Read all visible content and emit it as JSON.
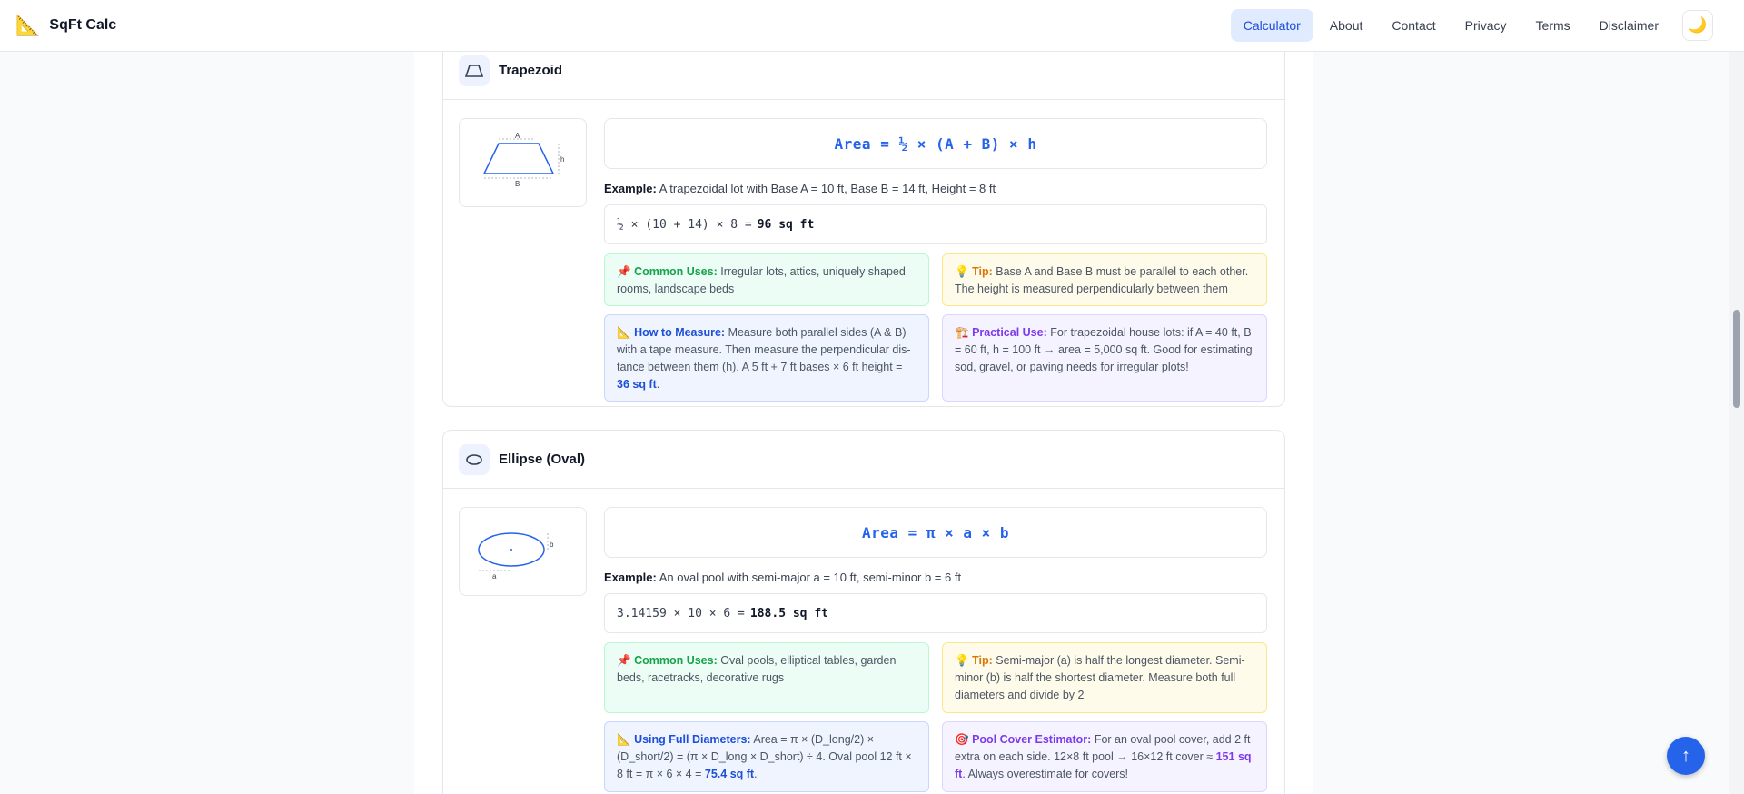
{
  "header": {
    "logo_icon": "📐",
    "app_name": "SqFt Calc",
    "nav": [
      "Calculator",
      "About",
      "Contact",
      "Privacy",
      "Terms",
      "Disclaimer"
    ],
    "active_nav": "Calculator",
    "theme_icon": "🌙"
  },
  "trapezoid": {
    "title": "Trapezoid",
    "diagram_labels": {
      "top": "A",
      "bottom": "B",
      "height": "h"
    },
    "formula": "Area = ½ × (A + B) × h",
    "example_label": "Example:",
    "example_text": "A trapezoidal lot with Base A = 10 ft, Base B = 14 ft, Height = 8 ft",
    "calc_expr": "½ × (10 + 14) × 8 =",
    "calc_result": "96 sq ft",
    "tips": {
      "common": {
        "icon": "📌",
        "label": "Common Uses:",
        "text": "Irregular lots, attics, uniquely shaped rooms, landscape beds"
      },
      "tip": {
        "icon": "💡",
        "label": "Tip:",
        "text": "Base A and Base B must be parallel to each other. The height is measured perpendicularly between them"
      },
      "measure": {
        "icon": "📐",
        "label": "How to Measure:",
        "text": "Measure both parallel sides (A & B) with a tape measure. Then measure the perpendicular dis­tance between them (h). A 5 ft + 7 ft bases × 6 ft height =",
        "highlight": "36 sq ft",
        "end": "."
      },
      "practical": {
        "icon": "🏗️",
        "label": "Practical Use:",
        "text": "For trapezoidal house lots: if A = 40 ft, B = 60 ft, h = 100 ft → area = 5,000 sq ft. Good for esti­mating sod, gravel, or paving needs for irregular plots!"
      }
    }
  },
  "ellipse": {
    "title": "Ellipse (Oval)",
    "diagram_labels": {
      "a": "a",
      "b": "b"
    },
    "formula": "Area = π × a × b",
    "example_label": "Example:",
    "example_text": "An oval pool with semi-major a = 10 ft, semi-minor b = 6 ft",
    "calc_expr": "3.14159 × 10 × 6 =",
    "calc_result": "188.5 sq ft",
    "tips": {
      "common": {
        "icon": "📌",
        "label": "Common Uses:",
        "text": "Oval pools, elliptical tables, garden beds, racetracks, decorative rugs"
      },
      "tip": {
        "icon": "💡",
        "label": "Tip:",
        "text": "Semi-major (a) is half the longest diameter. Semi-minor (b) is half the shortest diameter. Measure both full diameters and divide by 2"
      },
      "diameters": {
        "icon": "📐",
        "label": "Using Full Diameters:",
        "text": "Area = π × (D_long/2) × (D_short/2) = (π × D_long × D_short) ÷ 4. Oval pool 12 ft × 8 ft = π × 6 × 4 =",
        "highlight": "75.4 sq ft",
        "end": "."
      },
      "pool": {
        "icon": "🎯",
        "label": "Pool Cover Estimator:",
        "text": "For an oval pool cover, add 2 ft extra on each side. 12×8 ft pool → 16×12 ft cover ≈",
        "highlight": "151 sq ft",
        "end": ". Always overestimate for covers!"
      }
    }
  },
  "fab_icon": "↑"
}
